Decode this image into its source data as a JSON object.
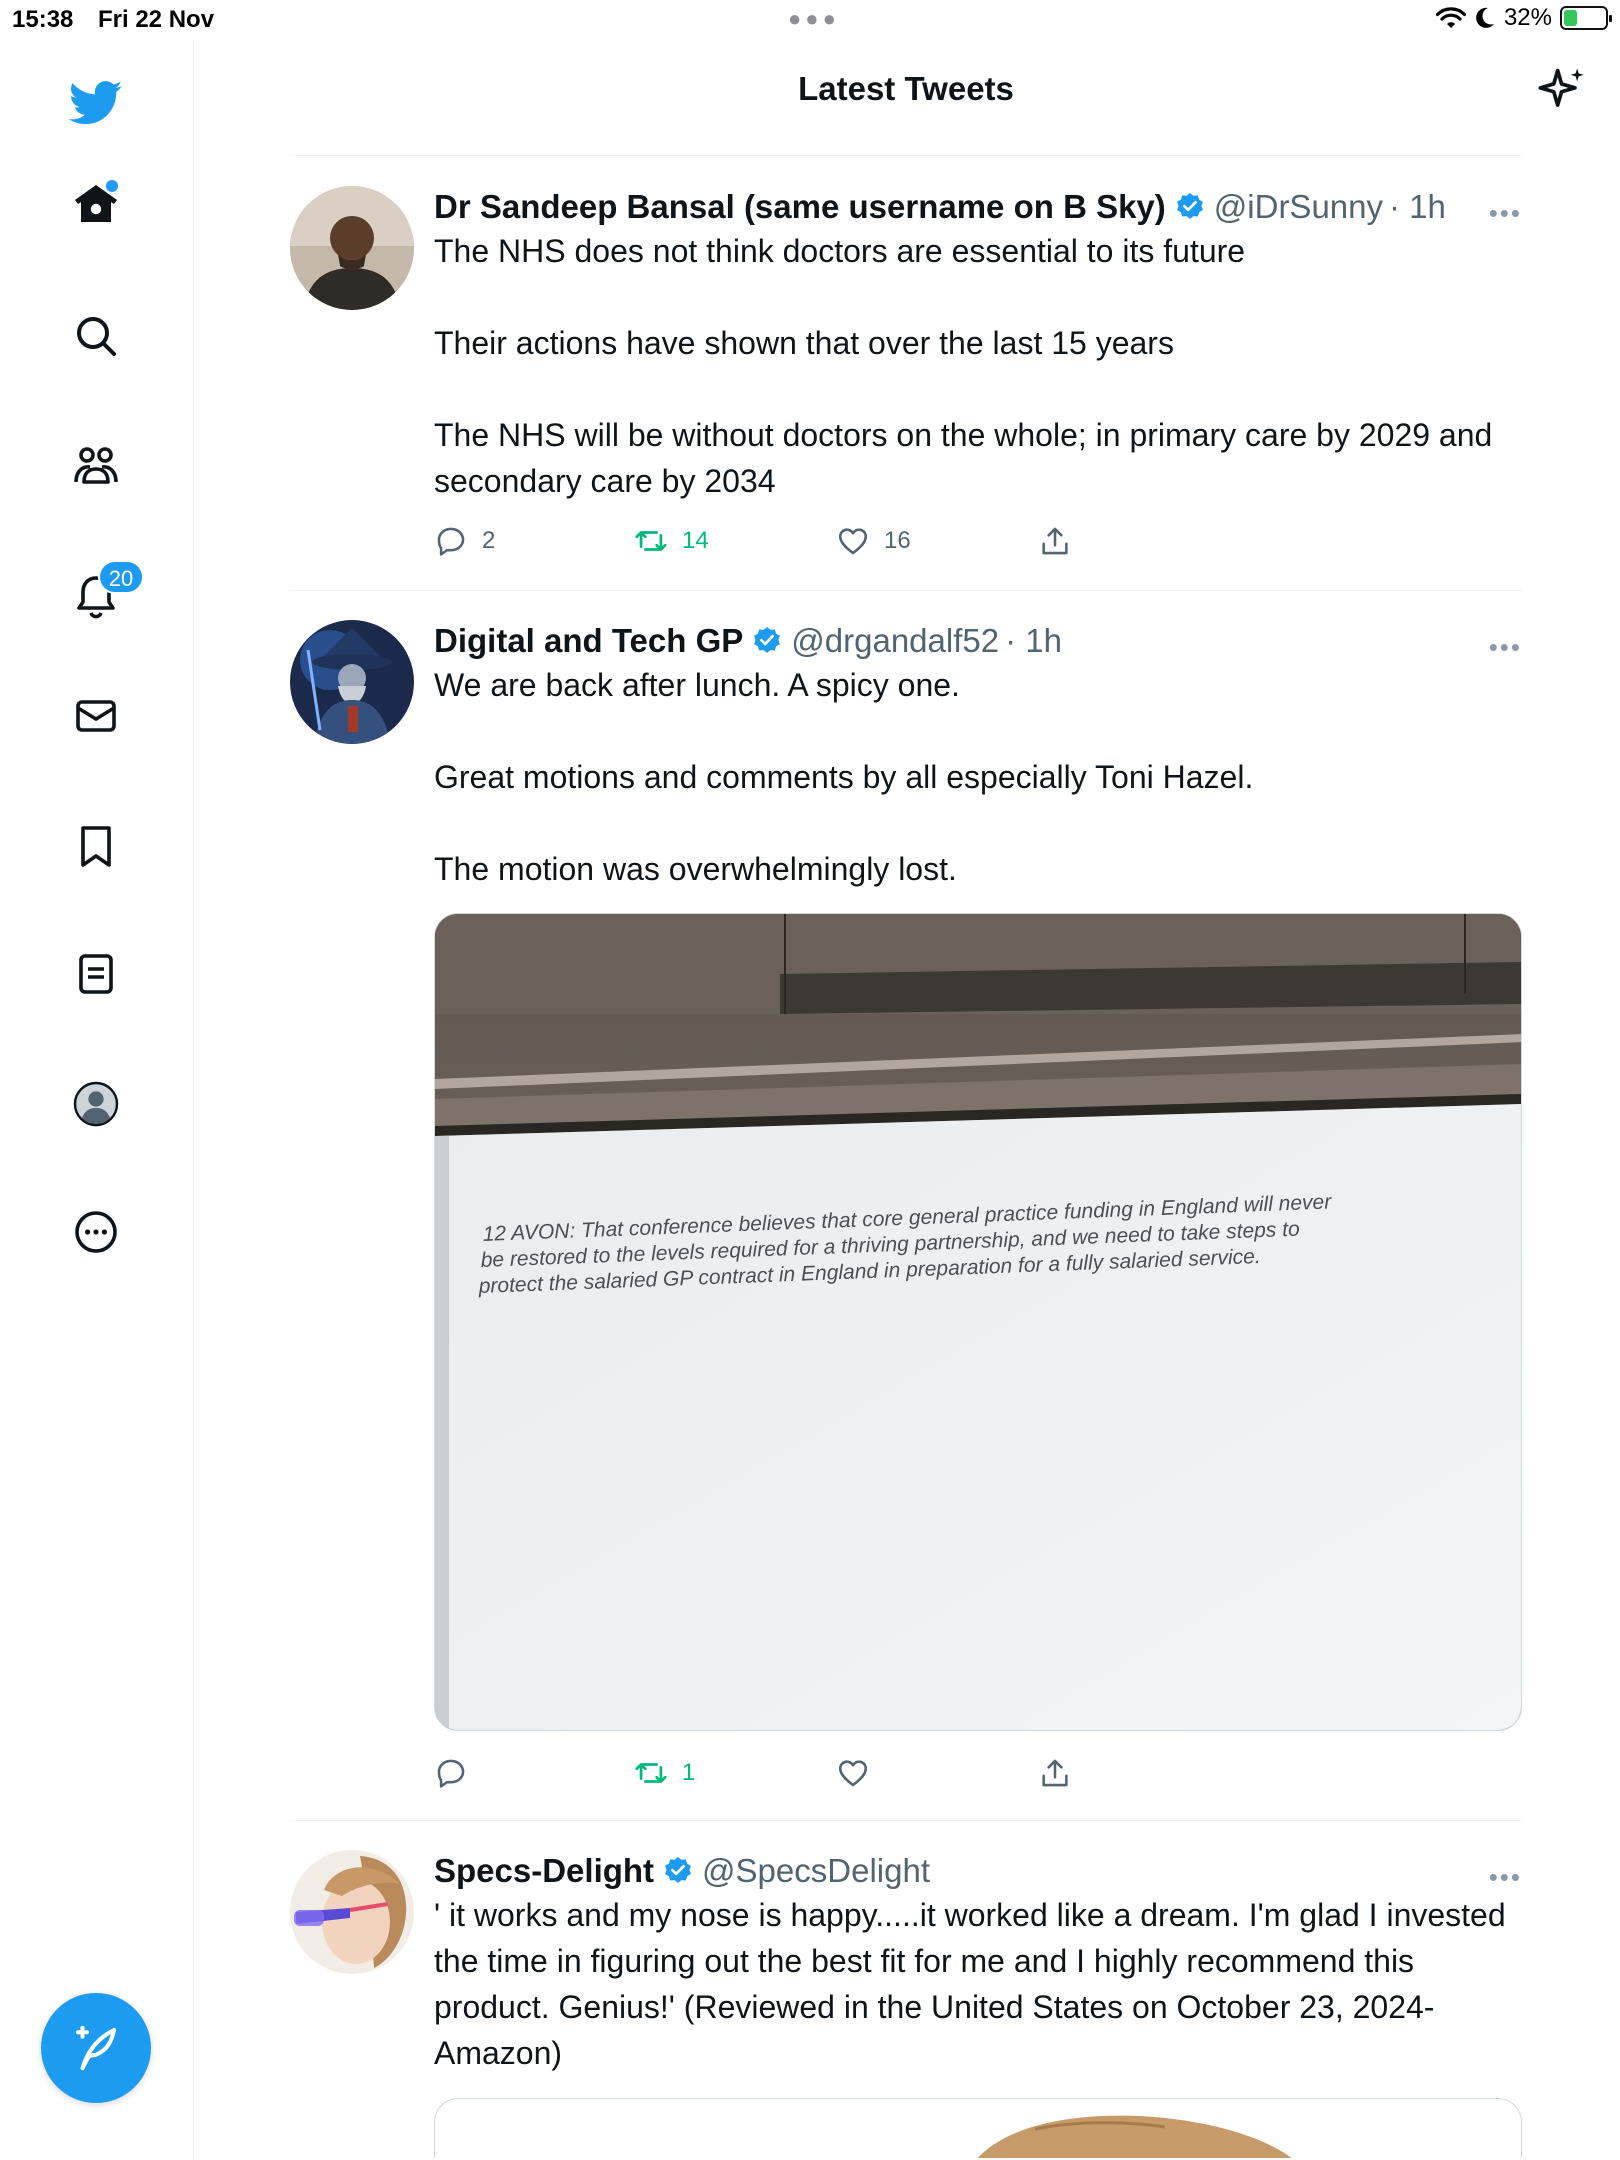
{
  "status_bar": {
    "time": "15:38",
    "date": "Fri 22 Nov",
    "battery": "32%",
    "battery_level": 0.32
  },
  "header": {
    "title": "Latest Tweets"
  },
  "sidebar": {
    "notifications_count": "20"
  },
  "tweets": [
    {
      "name": "Dr Sandeep Bansal (same username on B Sky)",
      "handle": "@iDrSunny",
      "time": "· 1h",
      "text": "The NHS does not think doctors are essential to its future\n\nTheir actions have shown that over the last 15 years\n\nThe NHS will be without doctors on the whole; in primary care by 2029 and secondary care by 2034",
      "replies": "2",
      "retweets": "14",
      "likes": "16"
    },
    {
      "name": "Digital and Tech GP",
      "handle": "@drgandalf52",
      "time": "· 1h",
      "text": "We are back after lunch. A spicy one.\n\nGreat motions and comments by all especially Toni Hazel.\n\nThe motion was overwhelmingly lost.",
      "media_text_line1": "12 AVON: That conference believes that core general practice funding in England will never",
      "media_text_line2": "be restored to the levels required for a thriving partnership, and we need to take steps to",
      "media_text_line3": "protect the salaried GP contract in England in preparation for a fully salaried service.",
      "replies": "",
      "retweets": "1",
      "likes": ""
    },
    {
      "name": "Specs-Delight",
      "handle": "@SpecsDelight",
      "time": "",
      "text": "' it works and my nose is happy.....it worked like a dream. I'm glad I invested the time in figuring out the best fit for me and I highly recommend this product. Genius!' (Reviewed in the United States on October 23, 2024-Amazon)"
    }
  ]
}
